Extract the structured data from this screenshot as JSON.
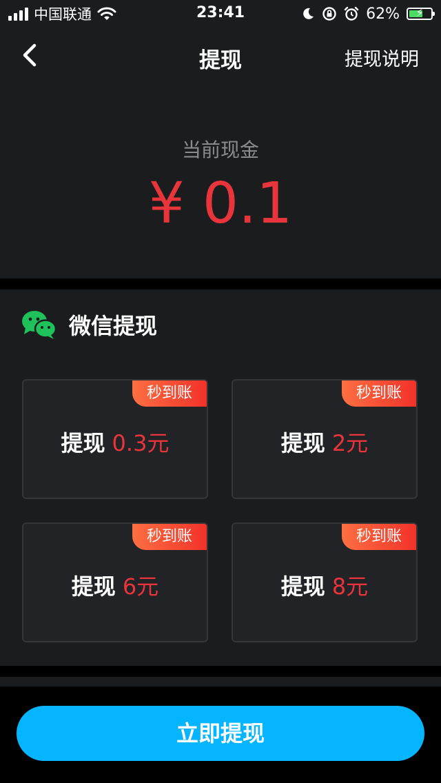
{
  "status_bar": {
    "carrier": "中国联通",
    "time": "23:41",
    "battery_percent": "62%",
    "battery_level": 0.62
  },
  "nav": {
    "title": "提现",
    "right_link": "提现说明"
  },
  "balance": {
    "label": "当前现金",
    "amount": "¥ 0.1"
  },
  "wechat": {
    "title": "微信提现",
    "options": [
      {
        "tag": "秒到账",
        "prefix": "提现",
        "amount": "0.3元"
      },
      {
        "tag": "秒到账",
        "prefix": "提现",
        "amount": "2元"
      },
      {
        "tag": "秒到账",
        "prefix": "提现",
        "amount": "6元"
      },
      {
        "tag": "秒到账",
        "prefix": "提现",
        "amount": "8元"
      }
    ]
  },
  "submit": {
    "label": "立即提现"
  },
  "colors": {
    "accent": "#05b5ff",
    "amount_red": "#e8353b",
    "tag_orange": "#f1322a",
    "wechat_green": "#1fc15a"
  }
}
